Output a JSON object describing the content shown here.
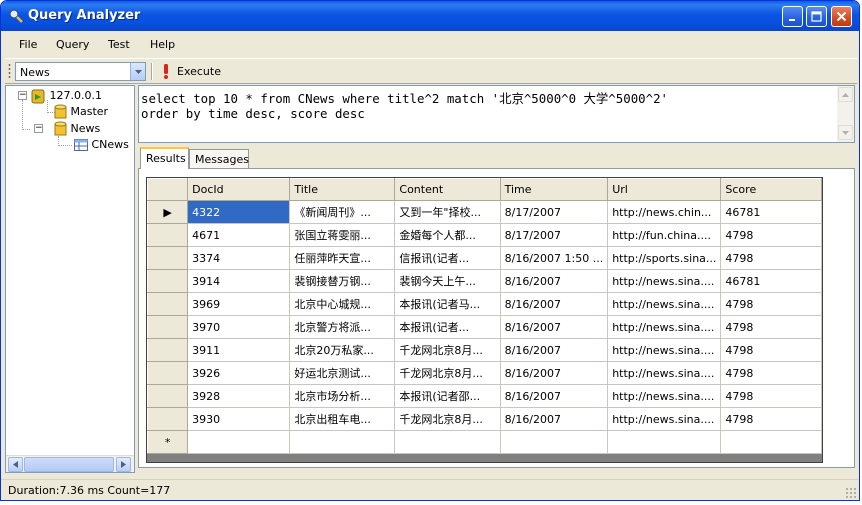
{
  "window": {
    "title": "Query Analyzer"
  },
  "menu": [
    "File",
    "Query",
    "Test",
    "Help"
  ],
  "toolbar": {
    "database": "News",
    "execute_label": "Execute"
  },
  "tree": {
    "server": "127.0.0.1",
    "databases": [
      "Master",
      "News"
    ],
    "tables": [
      "CNews"
    ]
  },
  "query": {
    "line1": "select top 10 * from CNews where title^2 match '北京^5000^0 大学^5000^2'",
    "line2": "order by time desc, score desc"
  },
  "tabs": [
    "Results",
    "Messages"
  ],
  "grid": {
    "columns": [
      "DocId",
      "Title",
      "Content",
      "Time",
      "Url",
      "Score"
    ],
    "rows": [
      [
        "4322",
        "《新闻周刊》...",
        "又到一年\"择校...",
        "8/17/2007",
        "http://news.chin...",
        "46781"
      ],
      [
        "4671",
        "张国立蒋雯丽...",
        "金婚每个人都...",
        "8/17/2007",
        "http://fun.china....",
        "4798"
      ],
      [
        "3374",
        "任丽萍昨天宣...",
        "信报讯(记者...",
        "8/16/2007 1:50 ...",
        "http://sports.sina...",
        "4798"
      ],
      [
        "3914",
        "裴钢接替万钢...",
        "裴钢今天上午...",
        "8/16/2007",
        "http://news.sina....",
        "46781"
      ],
      [
        "3969",
        "北京中心城规...",
        "本报讯(记者马...",
        "8/16/2007",
        "http://news.sina....",
        "4798"
      ],
      [
        "3970",
        "北京警方将派...",
        "本报讯(记者...",
        "8/16/2007",
        "http://news.sina....",
        "4798"
      ],
      [
        "3911",
        "北京20万私家...",
        "千龙网北京8月...",
        "8/16/2007",
        "http://news.sina....",
        "4798"
      ],
      [
        "3926",
        "好运北京测试...",
        "千龙网北京8月...",
        "8/16/2007",
        "http://news.sina....",
        "4798"
      ],
      [
        "3928",
        "北京市场分析...",
        "本报讯(记者邵...",
        "8/16/2007",
        "http://news.sina....",
        "4798"
      ],
      [
        "3930",
        "北京出租车电...",
        "千龙网北京8月...",
        "8/16/2007",
        "http://news.sina....",
        "4798"
      ]
    ],
    "new_row_marker": "*",
    "current_row_marker": "▶"
  },
  "status": {
    "text": "Duration:7.36 ms Count=177"
  },
  "icons": [
    "app-icon",
    "minimize-icon",
    "maximize-icon",
    "close-icon",
    "execute-icon",
    "server-icon",
    "database-icon",
    "table-icon"
  ],
  "colors": {
    "titlebar": "#0b55e3",
    "selection": "#316ac5",
    "chrome": "#ece9d8"
  }
}
